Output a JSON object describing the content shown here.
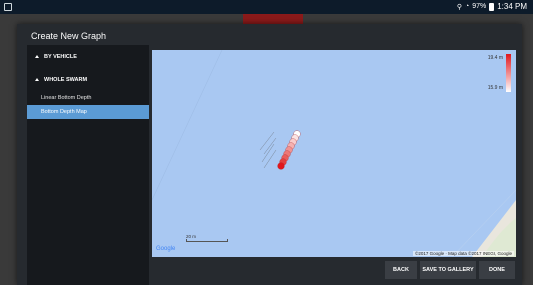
{
  "status_bar": {
    "time": "1:34 PM",
    "battery": "97%"
  },
  "dialog": {
    "title": "Create New Graph",
    "sidebar": {
      "sections": [
        {
          "label": "BY VEHICLE"
        },
        {
          "label": "WHOLE SWARM",
          "items": [
            "Linear Bottom Depth",
            "Bottom Depth Map"
          ],
          "selected": "Bottom Depth Map"
        }
      ]
    },
    "map": {
      "legend": {
        "max_label": "19.4 m",
        "min_label": "15.9 m",
        "colors": [
          "#e0161c",
          "#ffffff"
        ]
      },
      "scale_label": "20 m",
      "google_logo": "Google",
      "credit": "©2017 Google · Map data ©2017 INEGI, Google"
    },
    "buttons": {
      "back": "BACK",
      "save": "SAVE TO GALLERY",
      "done": "DONE"
    }
  }
}
